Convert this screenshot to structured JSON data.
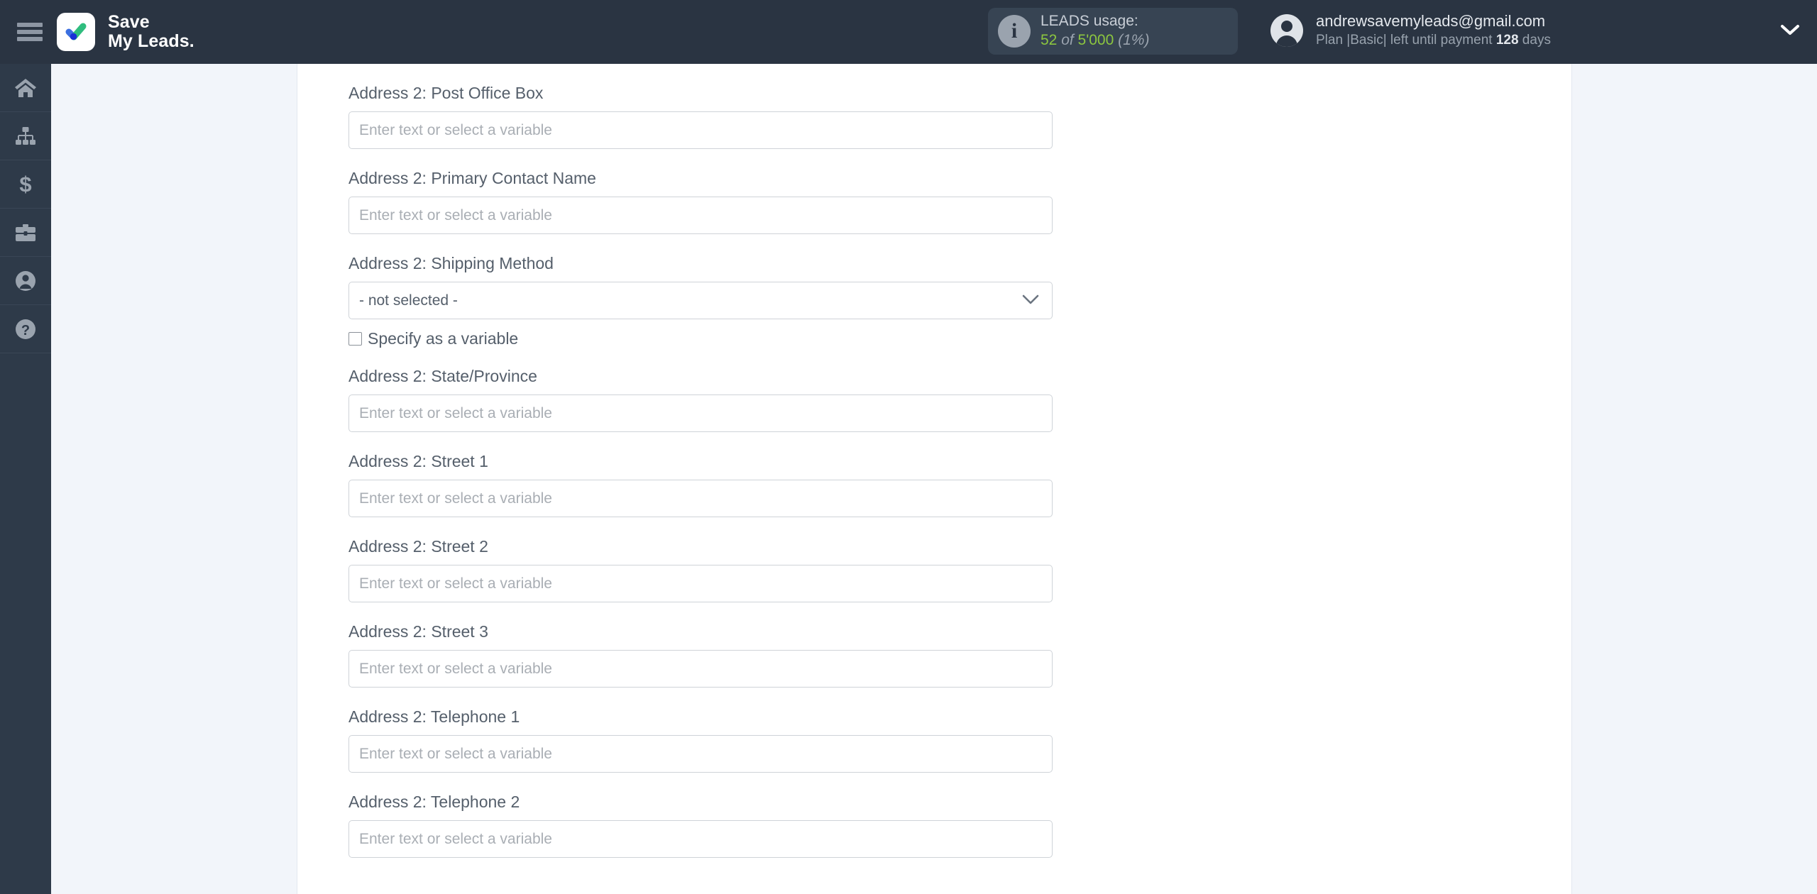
{
  "header": {
    "menu_icon": "hamburger-icon",
    "logo_icon": "checkmark-logo-icon",
    "brand_line1": "Save",
    "brand_line2": "My Leads.",
    "usage": {
      "info_icon": "info-icon",
      "title": "LEADS usage:",
      "used": "52",
      "of": " of ",
      "total": "5'000",
      "percent": " (1%)"
    },
    "account": {
      "avatar_icon": "user-avatar-icon",
      "email": "andrewsavemyleads@gmail.com",
      "plan_prefix": "Plan |Basic| left until payment ",
      "days": "128",
      "plan_suffix": " days",
      "caret_icon": "chevron-down-icon"
    }
  },
  "sidebar": {
    "items": [
      {
        "name": "home",
        "icon": "home-icon"
      },
      {
        "name": "connections",
        "icon": "sitemap-icon"
      },
      {
        "name": "billing",
        "icon": "dollar-icon"
      },
      {
        "name": "services",
        "icon": "briefcase-icon"
      },
      {
        "name": "profile",
        "icon": "user-icon"
      },
      {
        "name": "help",
        "icon": "question-mark-icon"
      }
    ]
  },
  "form": {
    "input_placeholder": "Enter text or select a variable",
    "fields": [
      {
        "label": "Address 2: Post Office Box",
        "type": "text"
      },
      {
        "label": "Address 2: Primary Contact Name",
        "type": "text"
      },
      {
        "label": "Address 2: Shipping Method",
        "type": "select",
        "value": "- not selected -",
        "checkbox_label": "Specify as a variable",
        "checked": false
      },
      {
        "label": "Address 2: State/Province",
        "type": "text"
      },
      {
        "label": "Address 2: Street 1",
        "type": "text"
      },
      {
        "label": "Address 2: Street 2",
        "type": "text"
      },
      {
        "label": "Address 2: Street 3",
        "type": "text"
      },
      {
        "label": "Address 2: Telephone 1",
        "type": "text"
      },
      {
        "label": "Address 2: Telephone 2",
        "type": "text"
      }
    ]
  },
  "colors": {
    "header_bg": "#2a3442",
    "sidebar_bg": "#2e3a49",
    "page_bg": "#f2f5fa",
    "panel_bg": "#ffffff",
    "accent_green": "#8cc63f",
    "logo_green": "#2fbd7e",
    "logo_blue": "#3b6fe0",
    "logo_darkblue": "#1b2fd6"
  }
}
